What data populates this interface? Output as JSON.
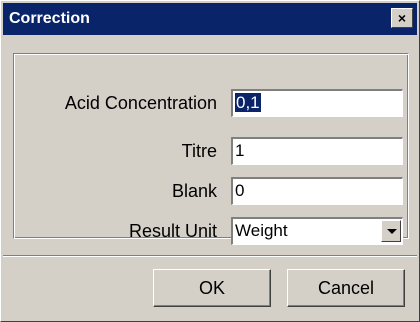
{
  "window": {
    "title": "Correction",
    "close_glyph": "×"
  },
  "form": {
    "acid_concentration": {
      "label": "Acid Concentration",
      "value": "0,1"
    },
    "titre": {
      "label": "Titre",
      "value": "1"
    },
    "blank": {
      "label": "Blank",
      "value": "0"
    },
    "result_unit": {
      "label": "Result Unit",
      "value": "Weight"
    }
  },
  "buttons": {
    "ok": "OK",
    "cancel": "Cancel"
  },
  "colors": {
    "titlebar": "#0a246a",
    "face": "#d4d0c8",
    "selection": "#0a246a"
  }
}
